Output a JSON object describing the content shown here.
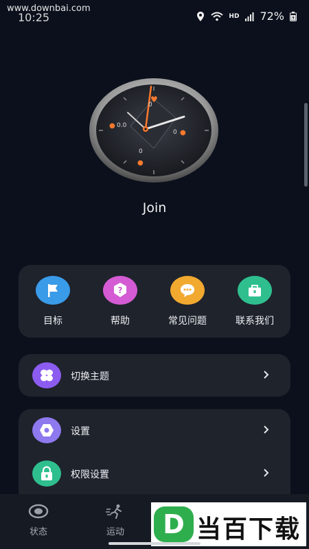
{
  "status_bar": {
    "watermark": "www.downbai.com",
    "time": "10:25",
    "battery_percent": "72%",
    "icons": [
      "location-icon",
      "wifi-icon",
      "hd-icon",
      "signal-icon",
      "battery-icon"
    ],
    "hd_label": "HD"
  },
  "watch": {
    "readings": [
      "0",
      "0.0",
      "0",
      "0"
    ],
    "accent_color": "#ff7a2e"
  },
  "profile": {
    "join_label": "Join"
  },
  "shortcuts": [
    {
      "label": "目标",
      "icon": "flag-icon",
      "color": "#3a9be8"
    },
    {
      "label": "帮助",
      "icon": "help-icon",
      "color": "#d45bd4"
    },
    {
      "label": "常见问题",
      "icon": "chat-icon",
      "color": "#f2a930"
    },
    {
      "label": "联系我们",
      "icon": "briefcase-icon",
      "color": "#2fbf8f"
    }
  ],
  "menu": {
    "theme": {
      "label": "切换主题",
      "icon": "theme-icon",
      "color": "#8c5cf0"
    },
    "settings": {
      "label": "设置",
      "icon": "settings-icon",
      "color": "#8e79ee"
    },
    "permissions": {
      "label": "权限设置",
      "icon": "lock-icon",
      "color": "#2fbf8f"
    }
  },
  "bottom_nav": [
    {
      "label": "状态",
      "icon": "status-icon"
    },
    {
      "label": "运动",
      "icon": "running-icon"
    }
  ],
  "watermark_logo": {
    "letter": "D",
    "text": "当百下载",
    "color": "#2fae4e"
  }
}
